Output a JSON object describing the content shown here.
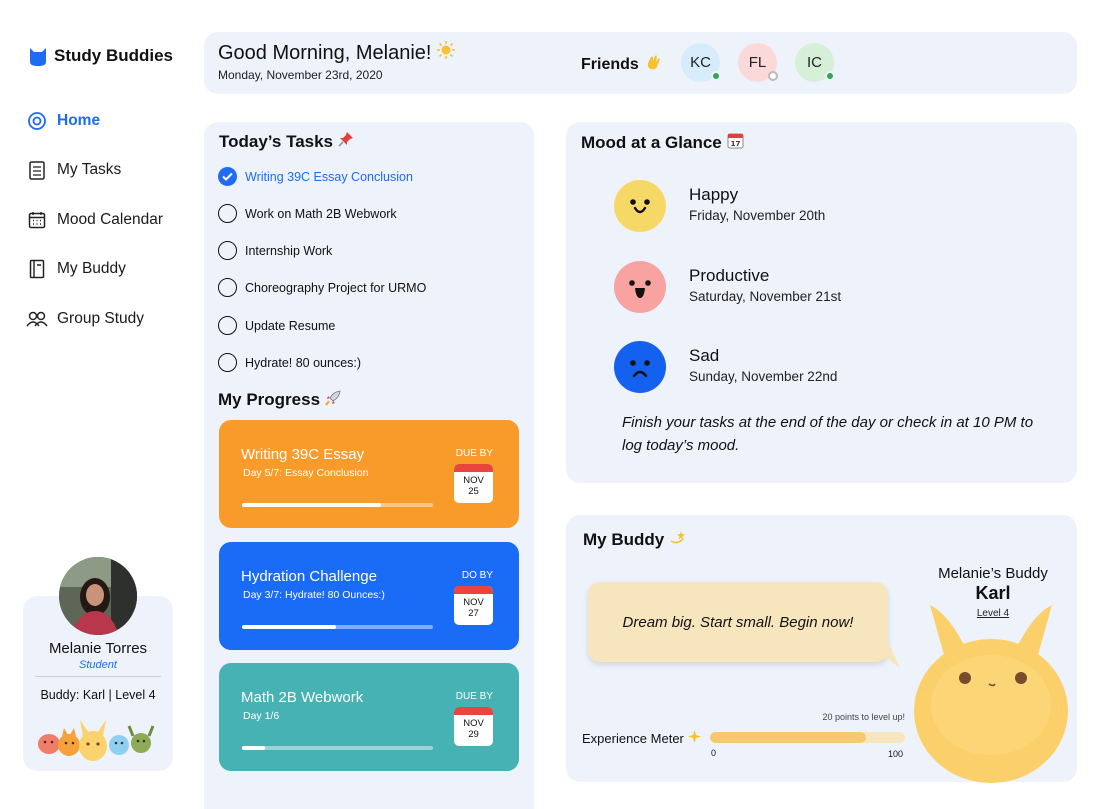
{
  "app": {
    "name": "Study Buddies",
    "logo_icon": "buddy-logo-icon",
    "accent": "#1f6bf2"
  },
  "nav": [
    {
      "label": "Home",
      "icon": "home-icon",
      "active": true
    },
    {
      "label": "My Tasks",
      "icon": "checklist-icon",
      "active": false
    },
    {
      "label": "Mood Calendar",
      "icon": "calendar-icon",
      "active": false
    },
    {
      "label": "My Buddy",
      "icon": "notebook-icon",
      "active": false
    },
    {
      "label": "Group Study",
      "icon": "group-icon",
      "active": false
    }
  ],
  "profile": {
    "name": "Melanie Torres",
    "role": "Student",
    "buddy": "Buddy: Karl | Level 4"
  },
  "header": {
    "greeting": "Good Morning, Melanie!",
    "greeting_emoji": "☀",
    "date": "Monday, November 23rd, 2020",
    "friends_label": "Friends",
    "friends_emoji": "👋",
    "friends": [
      {
        "initials": "KC",
        "bg": "#d7ecfa",
        "status": "online",
        "status_color": "#2fa84f"
      },
      {
        "initials": "FL",
        "bg": "#fbd9d9",
        "status": "offline",
        "status_color": "#ffffff"
      },
      {
        "initials": "IC",
        "bg": "#d5f0d6",
        "status": "online",
        "status_color": "#2fa84f"
      }
    ]
  },
  "tasks": {
    "title": "Today’s Tasks",
    "title_emoji": "📌",
    "items": [
      {
        "label": "Writing 39C Essay Conclusion",
        "done": true
      },
      {
        "label": "Work on Math 2B Webwork",
        "done": false
      },
      {
        "label": "Internship Work",
        "done": false
      },
      {
        "label": "Choreography Project for URMO",
        "done": false
      },
      {
        "label": "Update Resume",
        "done": false
      },
      {
        "label": "Hydrate! 80 ounces:)",
        "done": false
      }
    ]
  },
  "progress": {
    "title": "My Progress",
    "title_emoji": "🚀",
    "cards": [
      {
        "title": "Writing 39C Essay",
        "subtitle": "Day 5/7: Essay Conclusion",
        "due_label": "DUE BY",
        "month": "NOV",
        "day": "25",
        "progress": 0.73,
        "color": "#f99b2a"
      },
      {
        "title": "Hydration Challenge",
        "subtitle": "Day 3/7: Hydrate! 80 Ounces:)",
        "due_label": "DO BY",
        "month": "NOV",
        "day": "27",
        "progress": 0.49,
        "color": "#1a6bf5"
      },
      {
        "title": "Math 2B Webwork",
        "subtitle": "Day 1/6",
        "due_label": "DUE BY",
        "month": "NOV",
        "day": "29",
        "progress": 0.12,
        "color": "#47b2b3"
      }
    ]
  },
  "mood": {
    "title": "Mood at a Glance",
    "title_emoji": "📅",
    "entries": [
      {
        "mood": "Happy",
        "date": "Friday, November 20th",
        "color": "#f6d867",
        "face": "happy-face-icon"
      },
      {
        "mood": "Productive",
        "date": "Saturday, November 21st",
        "color": "#f8a3a1",
        "face": "excited-face-icon"
      },
      {
        "mood": "Sad",
        "date": "Sunday, November 22nd",
        "color": "#1461f0",
        "face": "sad-face-icon"
      }
    ],
    "note": "Finish your tasks at the end of the day or check in at 10 PM to log today’s mood."
  },
  "buddy": {
    "title": "My Buddy",
    "title_emoji": "💫",
    "quote": "Dream big. Start small. Begin now!",
    "owner_label": "Melanie’s Buddy",
    "name": "Karl",
    "level": "Level 4",
    "xp_label": "Experience Meter",
    "xp_emoji": "✨",
    "xp_hint": "20 points to level up!",
    "xp_min": "0",
    "xp_max": "100",
    "xp_value": 80,
    "color": "#fbd06a"
  }
}
